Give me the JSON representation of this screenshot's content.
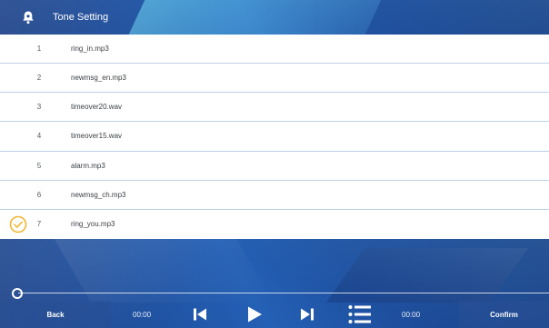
{
  "header": {
    "title": "Tone Setting",
    "icon": "bell-icon"
  },
  "tones": [
    {
      "num": "1",
      "name": "ring_in.mp3",
      "selected": false
    },
    {
      "num": "2",
      "name": "newmsg_en.mp3",
      "selected": false
    },
    {
      "num": "3",
      "name": "timeover20.wav",
      "selected": false
    },
    {
      "num": "4",
      "name": "timeover15.wav",
      "selected": false
    },
    {
      "num": "5",
      "name": "alarm.mp3",
      "selected": false
    },
    {
      "num": "6",
      "name": "newmsg_ch.mp3",
      "selected": false
    },
    {
      "num": "7",
      "name": "ring_you.mp3",
      "selected": true
    }
  ],
  "player": {
    "progress": 0,
    "current_time": "00:00",
    "total_time": "00:00",
    "back_label": "Back",
    "confirm_label": "Confirm"
  },
  "colors": {
    "accent_check": "#f2b632",
    "header_bg": "#1f4f9c",
    "row_divider": "#bcd0e6"
  }
}
